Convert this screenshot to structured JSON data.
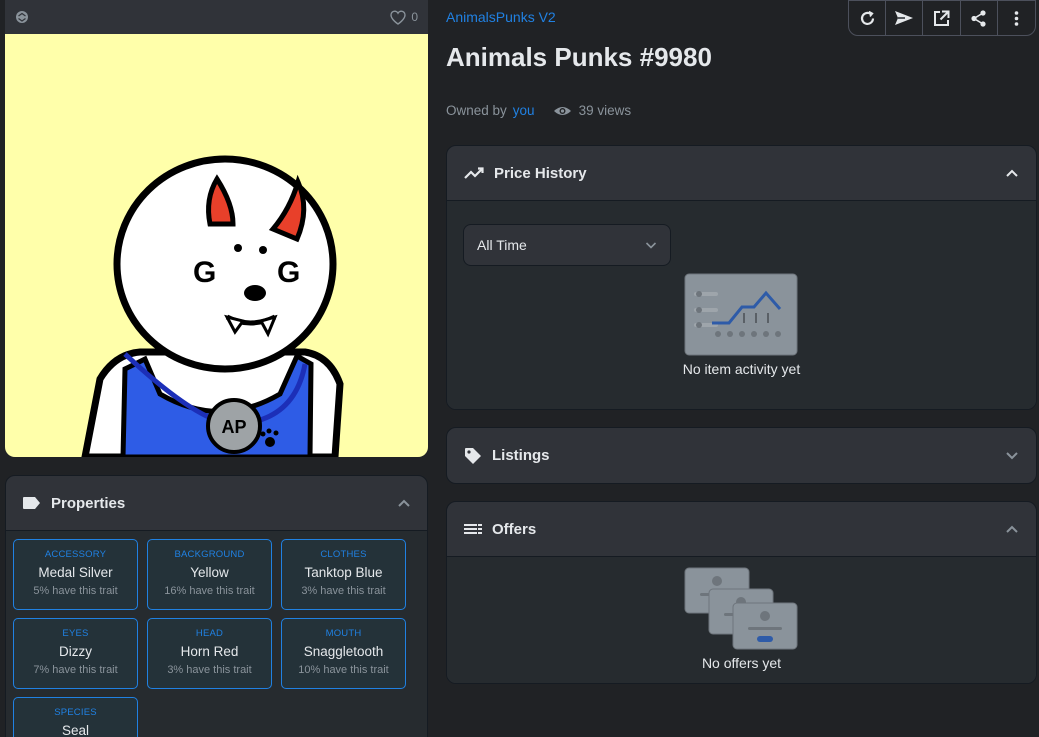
{
  "art": {
    "favorite_count": "0",
    "background_color": "#ffffaa",
    "badge_text": "AP"
  },
  "properties": {
    "title": "Properties",
    "traits": [
      {
        "type": "ACCESSORY",
        "value": "Medal Silver",
        "rarity": "5% have this trait"
      },
      {
        "type": "BACKGROUND",
        "value": "Yellow",
        "rarity": "16% have this trait"
      },
      {
        "type": "CLOTHES",
        "value": "Tanktop Blue",
        "rarity": "3% have this trait"
      },
      {
        "type": "EYES",
        "value": "Dizzy",
        "rarity": "7% have this trait"
      },
      {
        "type": "HEAD",
        "value": "Horn Red",
        "rarity": "3% have this trait"
      },
      {
        "type": "MOUTH",
        "value": "Snaggletooth",
        "rarity": "10% have this trait"
      },
      {
        "type": "SPECIES",
        "value": "Seal",
        "rarity": ""
      }
    ]
  },
  "header": {
    "collection": "AnimalsPunks V2",
    "title": "Animals Punks #9980",
    "owned_by_label": "Owned by",
    "owner": "you",
    "views": "39 views"
  },
  "toolbar": {
    "icons": [
      "refresh-icon",
      "send-icon",
      "external-link-icon",
      "share-icon",
      "more-icon"
    ]
  },
  "price_history": {
    "title": "Price History",
    "range_select": "All Time",
    "empty_text": "No item activity yet"
  },
  "listings": {
    "title": "Listings"
  },
  "offers": {
    "title": "Offers",
    "empty_text": "No offers yet"
  },
  "colors": {
    "accent": "#2081e2",
    "panel": "#303339",
    "background": "#202225"
  }
}
